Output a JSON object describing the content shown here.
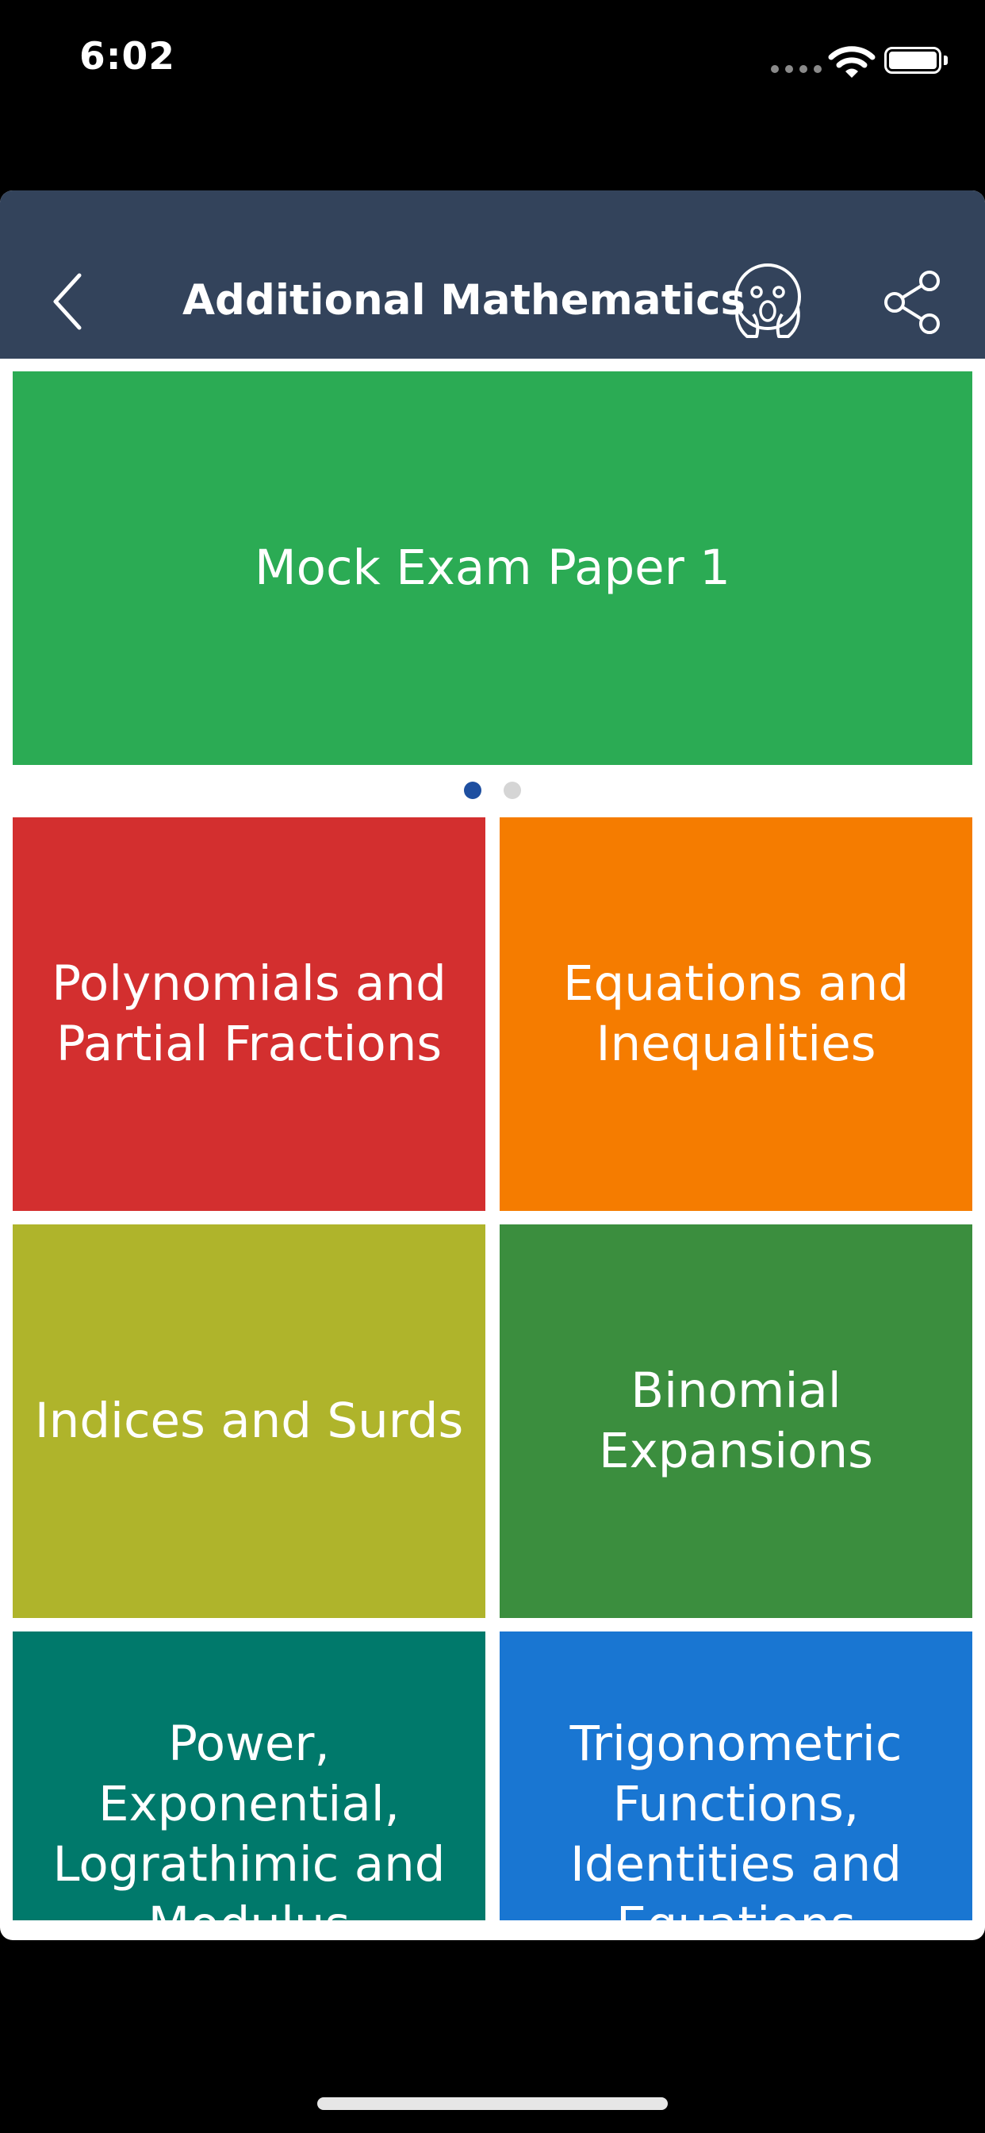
{
  "status_bar": {
    "time": "6:02"
  },
  "nav": {
    "title": "Additional Mathematics"
  },
  "carousel": {
    "slides": [
      {
        "label": "Mock Exam Paper 1",
        "color": "#2bab54"
      }
    ],
    "active_page": 1,
    "page_count": 2,
    "active_dot_color": "#1e4fa0",
    "inactive_dot_color": "#d5d5d5"
  },
  "topics": [
    {
      "label": "Polynomials and Partial Fractions",
      "color": "#d32f2f"
    },
    {
      "label": "Equations and Inequalities",
      "color": "#f57c00"
    },
    {
      "label": "Indices and Surds",
      "color": "#afb42b"
    },
    {
      "label": "Binomial Expansions",
      "color": "#3b8e3e"
    },
    {
      "label": "Power, Exponential, Lograthimic and Modulus Functions",
      "color": "#00796b"
    },
    {
      "label": "Trigonometric Functions, Identities and Equations",
      "color": "#1976d2"
    }
  ],
  "colors": {
    "nav_background": "#33435b",
    "page_background": "#ffffff"
  }
}
